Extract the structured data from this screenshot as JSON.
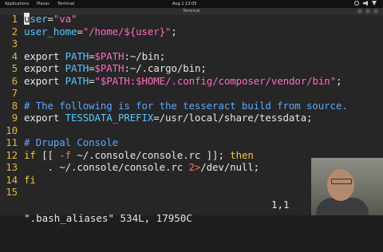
{
  "topbar": {
    "menu": [
      "Applications",
      "Places",
      "Terminal"
    ],
    "clock": "Aug 1  13:05"
  },
  "terminal": {
    "title": "Terminal"
  },
  "editor": {
    "lines": [
      {
        "n": "1",
        "segments": [
          {
            "t": "user",
            "c": "cyan"
          },
          {
            "t": "=",
            "c": "white"
          },
          {
            "t": "\"va\"",
            "c": "red"
          }
        ]
      },
      {
        "n": "2",
        "segments": [
          {
            "t": "user_home",
            "c": "cyan"
          },
          {
            "t": "=",
            "c": "white"
          },
          {
            "t": "\"/home/${user}\"",
            "c": "red"
          },
          {
            "t": ";",
            "c": "white"
          }
        ]
      },
      {
        "n": "3",
        "segments": []
      },
      {
        "n": "4",
        "segments": [
          {
            "t": "export ",
            "c": "white"
          },
          {
            "t": "PATH",
            "c": "cyan"
          },
          {
            "t": "=",
            "c": "white"
          },
          {
            "t": "$PATH",
            "c": "red"
          },
          {
            "t": ":~/bin;",
            "c": "white"
          }
        ]
      },
      {
        "n": "5",
        "segments": [
          {
            "t": "export ",
            "c": "white"
          },
          {
            "t": "PATH",
            "c": "cyan"
          },
          {
            "t": "=",
            "c": "white"
          },
          {
            "t": "$PATH",
            "c": "red"
          },
          {
            "t": ":~/.cargo/bin;",
            "c": "white"
          }
        ]
      },
      {
        "n": "6",
        "segments": [
          {
            "t": "export ",
            "c": "white"
          },
          {
            "t": "PATH",
            "c": "cyan"
          },
          {
            "t": "=",
            "c": "white"
          },
          {
            "t": "\"$PATH:$HOME",
            "c": "red"
          },
          {
            "t": "/.config/composer/vendor/bin\"",
            "c": "red"
          },
          {
            "t": ";",
            "c": "white"
          }
        ]
      },
      {
        "n": "7",
        "segments": []
      },
      {
        "n": "8",
        "segments": [
          {
            "t": "# The following is for the tesseract build from source.",
            "c": "comment"
          }
        ]
      },
      {
        "n": "9",
        "segments": [
          {
            "t": "export ",
            "c": "white"
          },
          {
            "t": "TESSDATA_PREFIX",
            "c": "cyan"
          },
          {
            "t": "=/usr/local/share/tessdata;",
            "c": "white"
          }
        ]
      },
      {
        "n": "10",
        "segments": []
      },
      {
        "n": "11",
        "segments": [
          {
            "t": "# Drupal Console",
            "c": "comment"
          }
        ]
      },
      {
        "n": "12",
        "segments": [
          {
            "t": "if",
            "c": "yellow"
          },
          {
            "t": " [[ ",
            "c": "white"
          },
          {
            "t": "-f",
            "c": "kw"
          },
          {
            "t": " ~/.console/console.rc ]]; ",
            "c": "white"
          },
          {
            "t": "then",
            "c": "yellow"
          }
        ]
      },
      {
        "n": "13",
        "segments": [
          {
            "t": "    . ~/.console/console.rc ",
            "c": "white"
          },
          {
            "t": "2>",
            "c": "kw"
          },
          {
            "t": "/dev/null;",
            "c": "white"
          }
        ]
      },
      {
        "n": "14",
        "segments": [
          {
            "t": "fi",
            "c": "yellow"
          }
        ]
      },
      {
        "n": "15",
        "segments": []
      }
    ],
    "status_file": "\".bash_aliases\" 534L, 17950C",
    "status_pos": "1,1"
  }
}
